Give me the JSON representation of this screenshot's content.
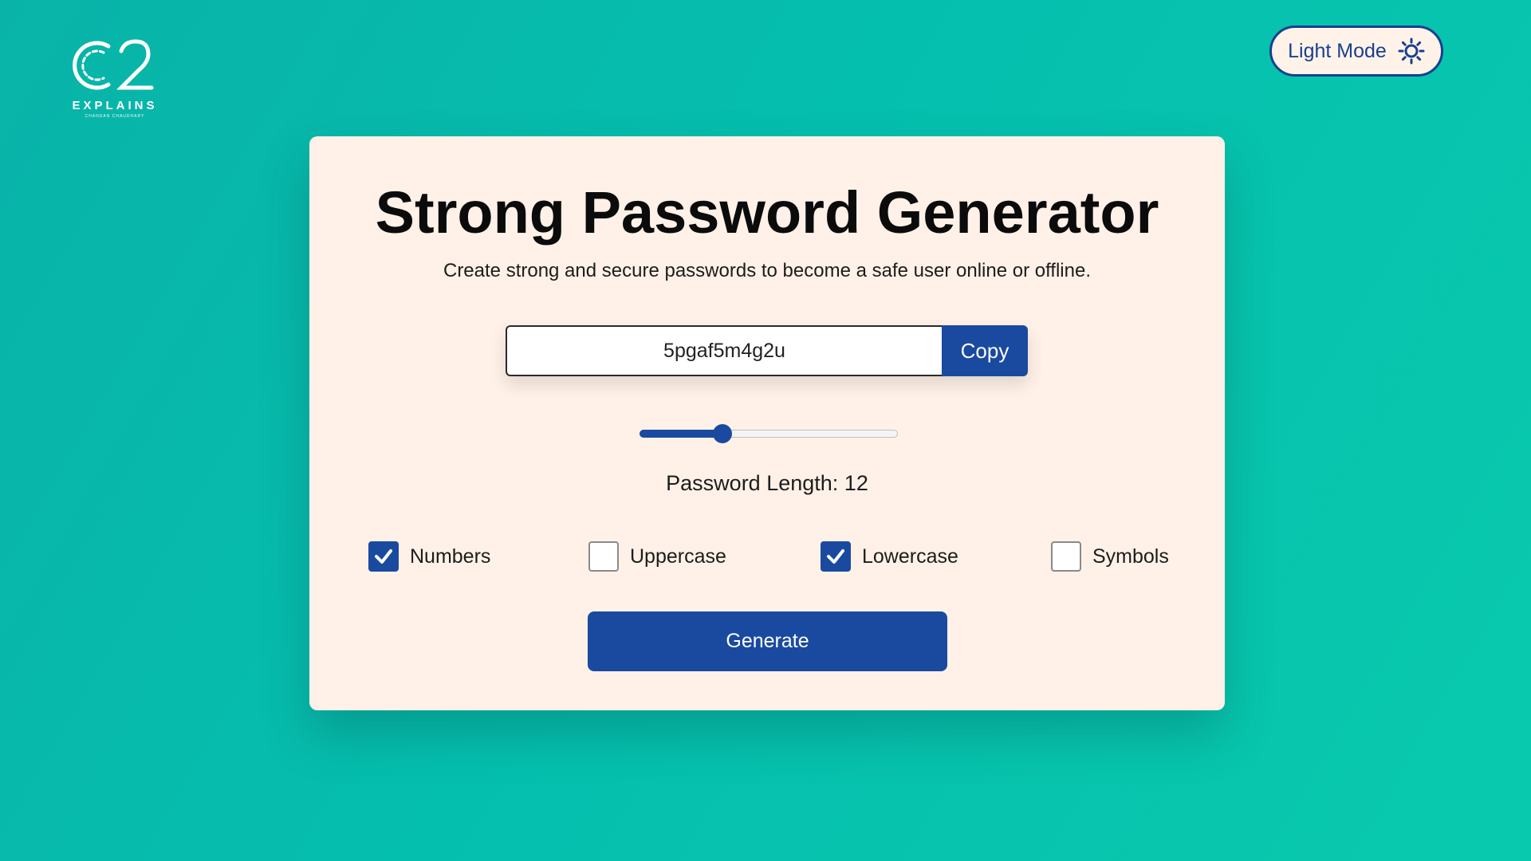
{
  "logo": {
    "mark": "C2",
    "word": "EXPLAINS",
    "sub": "CHANDAN CHAUDHARY"
  },
  "header": {
    "mode_label": "Light Mode",
    "mode_icon": "sun-icon"
  },
  "card": {
    "title": "Strong Password Generator",
    "subtitle": "Create strong and secure passwords to become a safe user online or offline.",
    "password_value": "5pgaf5m4g2u",
    "copy_label": "Copy",
    "slider_fraction": 0.32,
    "length_label": "Password Length: ",
    "length_value": "12",
    "options": [
      {
        "label": "Numbers",
        "checked": true
      },
      {
        "label": "Uppercase",
        "checked": false
      },
      {
        "label": "Lowercase",
        "checked": true
      },
      {
        "label": "Symbols",
        "checked": false
      }
    ],
    "generate_label": "Generate"
  },
  "colors": {
    "background": "#05bfae",
    "card": "#fff1e7",
    "accent": "#1a4aa0",
    "toggle_border": "#1a3f8f"
  }
}
